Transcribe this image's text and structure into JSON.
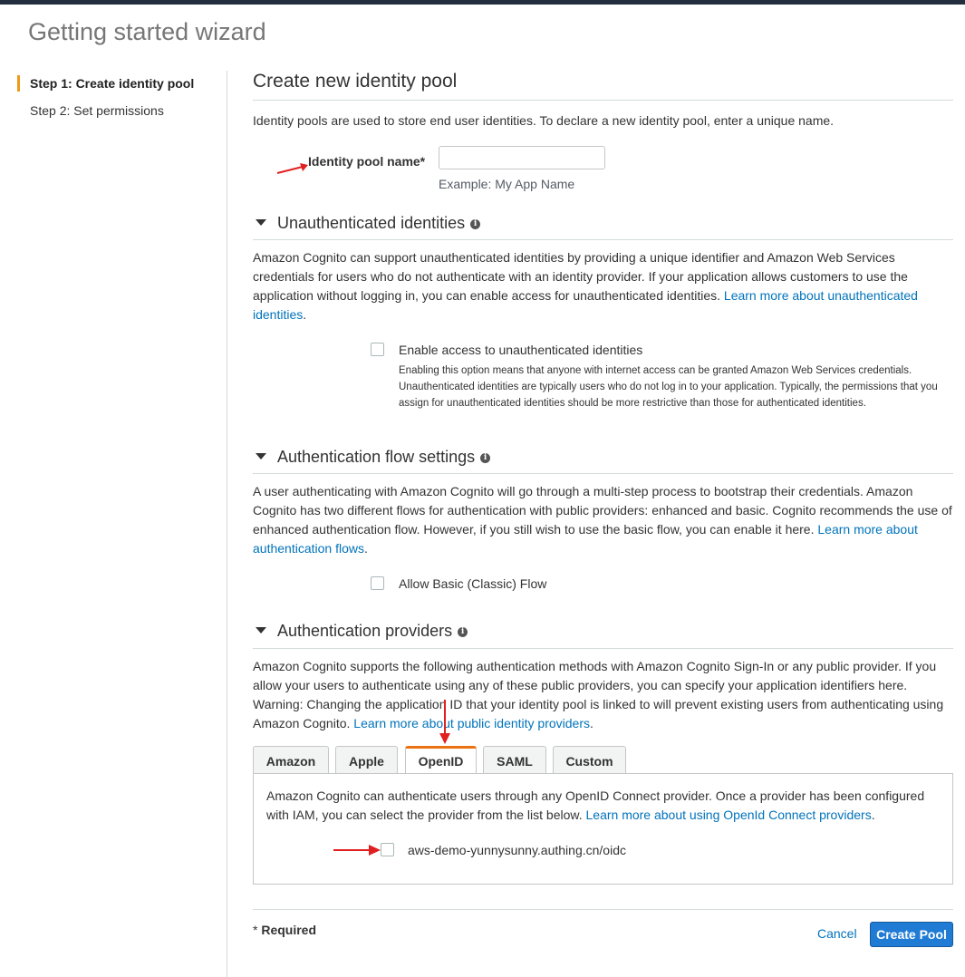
{
  "wizard": {
    "title": "Getting started wizard"
  },
  "sidebar": {
    "steps": [
      {
        "label": "Step 1: Create identity pool",
        "active": true
      },
      {
        "label": "Step 2: Set permissions",
        "active": false
      }
    ]
  },
  "main": {
    "title": "Create new identity pool",
    "intro": "Identity pools are used to store end user identities. To declare a new identity pool, enter a unique name.",
    "pool_name": {
      "label": "Identity pool name*",
      "value": "",
      "hint": "Example: My App Name"
    }
  },
  "unauth": {
    "heading": "Unauthenticated identities",
    "text": "Amazon Cognito can support unauthenticated identities by providing a unique identifier and Amazon Web Services credentials for users who do not authenticate with an identity provider. If your application allows customers to use the application without logging in, you can enable access for unauthenticated identities. ",
    "link": "Learn more about unauthenticated identities",
    "period": ".",
    "checkbox_label": "Enable access to unauthenticated identities",
    "checkbox_desc": "Enabling this option means that anyone with internet access can be granted Amazon Web Services credentials. Unauthenticated identities are typically users who do not log in to your application. Typically, the permissions that you assign for unauthenticated identities should be more restrictive than those for authenticated identities."
  },
  "authflow": {
    "heading": "Authentication flow settings",
    "text": "A user authenticating with Amazon Cognito will go through a multi-step process to bootstrap their credentials. Amazon Cognito has two different flows for authentication with public providers: enhanced and basic. Cognito recommends the use of enhanced authentication flow. However, if you still wish to use the basic flow, you can enable it here. ",
    "link": "Learn more about authentication flows",
    "period": ".",
    "checkbox_label": "Allow Basic (Classic) Flow"
  },
  "providers": {
    "heading": "Authentication providers",
    "text": "Amazon Cognito supports the following authentication methods with Amazon Cognito Sign-In or any public provider. If you allow your users to authenticate using any of these public providers, you can specify your application identifiers here. Warning: Changing the application ID that your identity pool is linked to will prevent existing users from authenticating using Amazon Cognito. ",
    "link": "Learn more about public identity providers",
    "period": ".",
    "tabs": [
      "Amazon",
      "Apple",
      "OpenID",
      "SAML",
      "Custom"
    ],
    "active_tab": "OpenID",
    "openid_text": "Amazon Cognito can authenticate users through any OpenID Connect provider. Once a provider has been configured with IAM, you can select the provider from the list below. ",
    "openid_link": "Learn more about using OpenId Connect providers",
    "openid_period": ".",
    "provider_option": "aws-demo-yunnysunny.authing.cn/oidc"
  },
  "footer": {
    "required_star": "* ",
    "required_label": "Required",
    "cancel": "Cancel",
    "create": "Create Pool"
  },
  "colors": {
    "accent_orange": "#ec7211",
    "link_blue": "#0073bb",
    "primary_button": "#1f7bd4",
    "annotation_arrow": "#e02020"
  }
}
